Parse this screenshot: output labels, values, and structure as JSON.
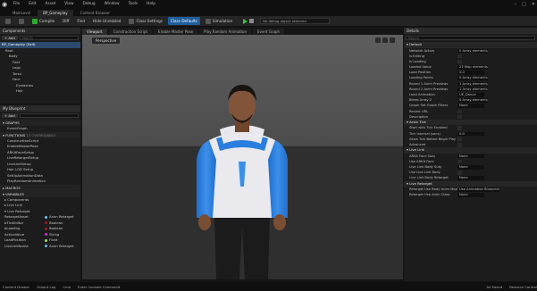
{
  "menu": [
    "File",
    "Edit",
    "Asset",
    "View",
    "Debug",
    "Window",
    "Tools",
    "Help"
  ],
  "tabs": [
    "MainLevel",
    "BP_Gameplay",
    "Content Browser"
  ],
  "toolbar": {
    "compile": "Compile",
    "diff": "Diff",
    "find": "Find",
    "hide_unrelated": "Hide Unrelated",
    "class_settings": "Class Settings",
    "class_defaults": "Class Defaults",
    "simulation": "Simulation",
    "debug_object": "No debug object selected"
  },
  "components": {
    "title": "Components",
    "add_label": "+ Add",
    "search_placeholder": "Search",
    "items": [
      {
        "label": "BP_Gameplay (Self)",
        "selected": true
      },
      {
        "label": "Root",
        "selected": false
      },
      {
        "label": "Body",
        "selected": false
      },
      {
        "label": "Feet",
        "selected": false
      },
      {
        "label": "Legs",
        "selected": false
      },
      {
        "label": "Torso",
        "selected": false
      },
      {
        "label": "Face",
        "selected": false
      },
      {
        "label": "Eyelashes",
        "selected": false
      },
      {
        "label": "Hair",
        "selected": false
      }
    ]
  },
  "myblueprint": {
    "title": "My Blueprint",
    "add_label": "+ Add",
    "graphs_label": "GRAPHS",
    "event_graph": "EventGraph",
    "functions_label": "FUNCTIONS",
    "functions_count": "13 OVERRIDABLE",
    "functions": [
      "ConstructionScript",
      "EnableMasterPose",
      "ARKitFaceSetup",
      "LiveRetargetSetup",
      "LiveLinkSetup",
      "Hair LOD Setup",
      "SetUpAnimationData",
      "PlayRandomAnimation"
    ],
    "macros_label": "MACROS",
    "variables_label": "VARIABLES",
    "components_label": "Components",
    "livelink_label": "Live Link",
    "liveretarget_label": "Live Retarget",
    "variables": [
      {
        "name": "RetargetAsset",
        "type": "Anim Retarget",
        "color": "#5fc4ff"
      },
      {
        "name": "bTickEditor",
        "type": "Boolean",
        "color": "#b01515"
      },
      {
        "name": "bLoading",
        "type": "Boolean",
        "color": "#b01515"
      },
      {
        "name": "ActiveValue",
        "type": "String",
        "color": "#d629d6"
      },
      {
        "name": "LoadPosition",
        "type": "Float",
        "color": "#9ae05a"
      },
      {
        "name": "LiveLinkName",
        "type": "Anim Retarget",
        "color": "#5fc4ff"
      }
    ]
  },
  "viewport": {
    "tabs": [
      "Viewport",
      "Construction Script",
      "Enable Master Pose",
      "Play Random Animation",
      "Event Graph"
    ],
    "mode": "Perspective"
  },
  "details": {
    "title": "Details",
    "search_placeholder": "Search",
    "sections": [
      "Default",
      "Actor Tick",
      "Live Link",
      "Live Retarget"
    ],
    "rows_default": [
      {
        "label": "Network Actors",
        "value": "0 Array elements"
      },
      {
        "label": "Is Editing",
        "value": ""
      },
      {
        "label": "Is Loading",
        "value": ""
      },
      {
        "label": "Loaded Value",
        "value": "27 Map elements"
      },
      {
        "label": "Load Position",
        "value": "0.0"
      },
      {
        "label": "Loading Points",
        "value": "0 Array elements"
      },
      {
        "label": "Round 1 Anim Previews",
        "value": "1 Array elements"
      },
      {
        "label": "Round 2 Anim Previews",
        "value": "1 Array elements"
      },
      {
        "label": "Load Animation",
        "value": "UE_Dance"
      },
      {
        "label": "Blend Array 2",
        "value": "0 Array elements"
      },
      {
        "label": "Graph Set Graph Filters",
        "value": "None"
      },
      {
        "label": "Recent URL",
        "value": ""
      },
      {
        "label": "Description",
        "value": ""
      }
    ],
    "rows_tick": [
      {
        "label": "Start with Tick Enabled",
        "value": ""
      },
      {
        "label": "Tick Interval (secs)",
        "value": "0.0"
      },
      {
        "label": "Allow Tick Before Begin Play",
        "value": ""
      },
      {
        "label": "Advanced",
        "value": ""
      }
    ],
    "rows_livelink": [
      {
        "label": "ARKit Face Subj",
        "value": "None"
      },
      {
        "label": "Use ARKit Face",
        "value": ""
      },
      {
        "label": "Live Link Body Subj",
        "value": "None"
      },
      {
        "label": "Use Live Link Body",
        "value": ""
      },
      {
        "label": "Live Link Body Retarget",
        "value": "None"
      }
    ],
    "rows_retarget": [
      {
        "label": "Retarget Use Body Anim Mode",
        "value": "Use Animation Blueprint"
      },
      {
        "label": "Retarget Use Anim Class",
        "value": "None"
      }
    ]
  },
  "statusbar": [
    "Content Drawer",
    "Output Log",
    "Cmd",
    "Enter Console Command",
    "All Saved",
    "Revision Control"
  ]
}
